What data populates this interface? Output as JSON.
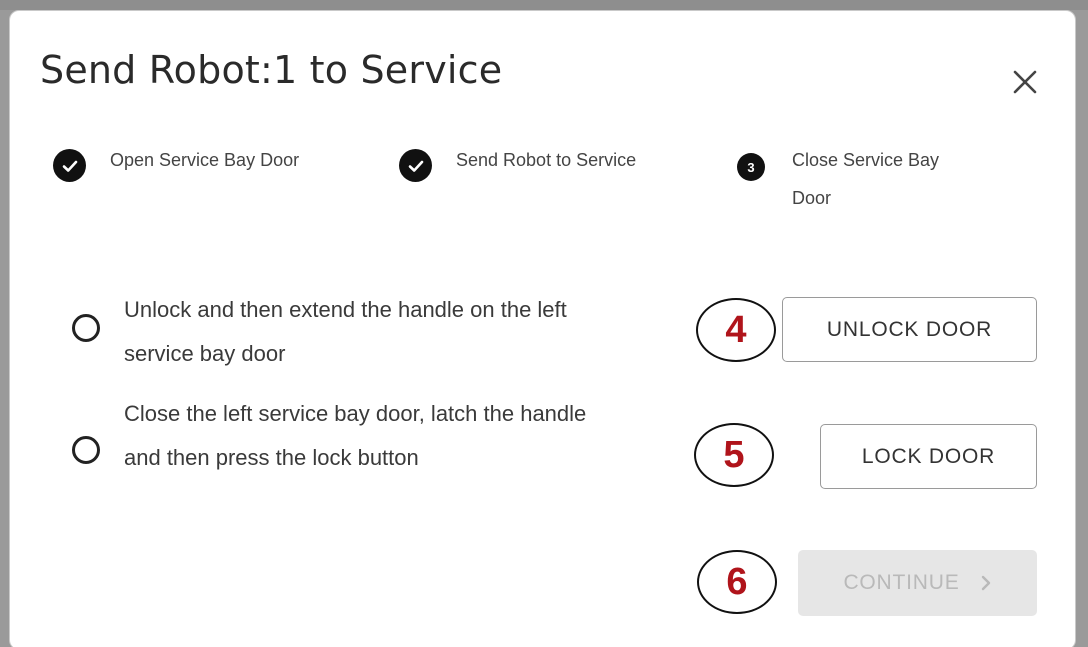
{
  "dialog": {
    "title": "Send Robot:1 to Service",
    "close_label": "×"
  },
  "steps": [
    {
      "status": "complete",
      "icon": "check-circle-icon",
      "label": "Open Service Bay Door"
    },
    {
      "status": "complete",
      "icon": "check-circle-icon",
      "label": "Send Robot to Service"
    },
    {
      "status": "current",
      "number": "3",
      "label": "Close Service Bay Door"
    }
  ],
  "tasks": [
    {
      "text": "Unlock and then extend the handle on the left service bay door",
      "checked": false
    },
    {
      "text": "Close the left service bay door, latch the handle and then press the lock button",
      "checked": false
    }
  ],
  "markers": [
    "4",
    "5",
    "6"
  ],
  "buttons": {
    "unlock": "UNLOCK DOOR",
    "lock": "LOCK DOOR",
    "continue": "CONTINUE",
    "continue_enabled": false
  },
  "colors": {
    "marker_text": "#b0141b",
    "step_badge": "#111111",
    "disabled_button_bg": "#e6e6e6",
    "disabled_button_text": "#b9b9b9"
  }
}
